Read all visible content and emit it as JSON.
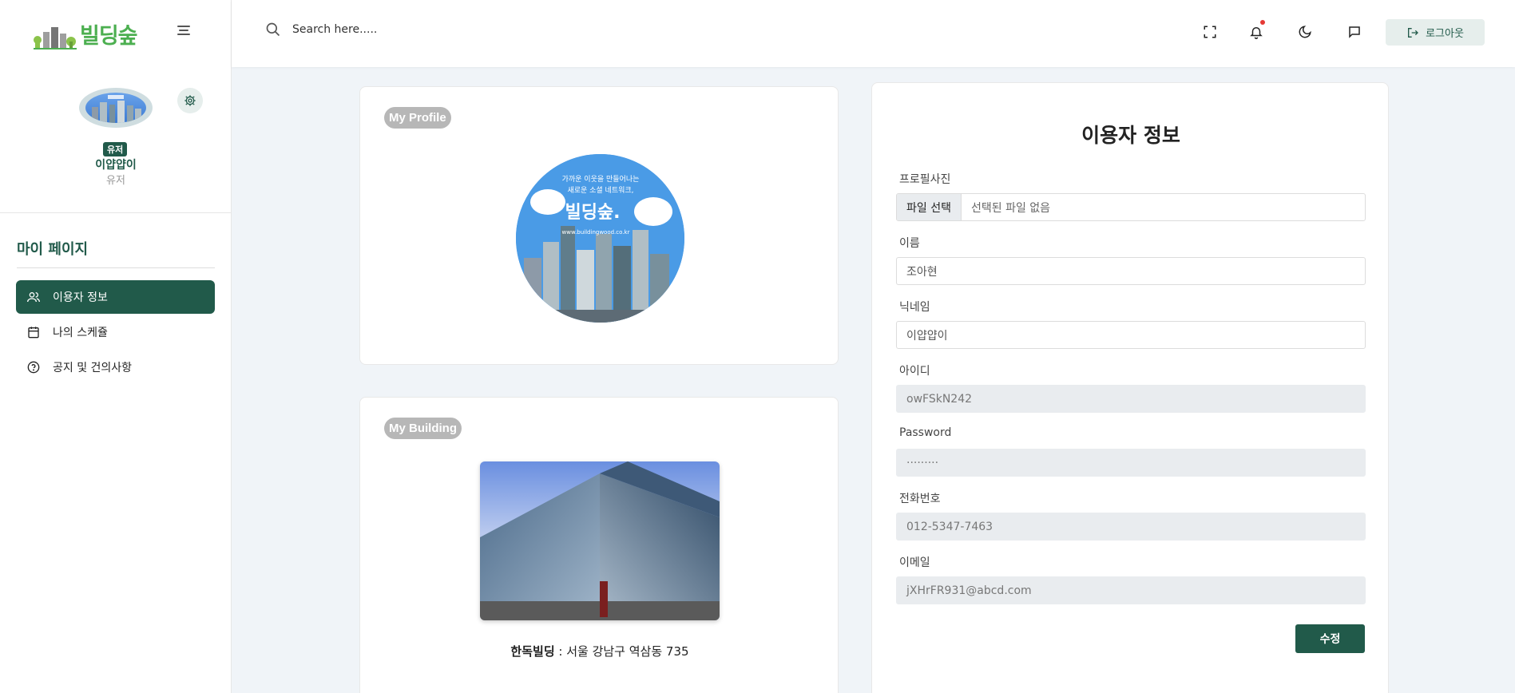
{
  "app": {
    "logo_text": "빌딩숲"
  },
  "header": {
    "search_placeholder": "Search here.....",
    "logout_label": "로그아웃",
    "icons": [
      "fullscreen-icon",
      "bell-icon",
      "moon-icon",
      "chat-icon"
    ]
  },
  "sidebar": {
    "profile": {
      "badge": "유저",
      "nickname": "이얍얍이",
      "role": "유저"
    },
    "nav_title": "마이 페이지",
    "items": [
      {
        "label": "이용자 정보",
        "icon": "users-icon",
        "active": true
      },
      {
        "label": "나의 스케쥴",
        "icon": "calendar-icon",
        "active": false
      },
      {
        "label": "공지 및 건의사항",
        "icon": "question-circle-icon",
        "active": false
      }
    ]
  },
  "profile_card": {
    "label": "My Profile",
    "photo_text": {
      "tagline1": "가까운 이웃을 만들어나는",
      "tagline2": "새로운 소셜 네트워크,",
      "brand": "빌딩숲.",
      "url": "www.buildingwood.co.kr"
    }
  },
  "building_card": {
    "label": "My Building",
    "caption_name": "한독빌딩",
    "caption_address": " : 서울 강남구 역삼동 735"
  },
  "form": {
    "title": "이용자 정보",
    "photo_label": "프로필사진",
    "file_button": "파일 선택",
    "file_status": "선택된 파일 없음",
    "name_label": "이름",
    "name_value": "조아현",
    "nickname_label": "닉네임",
    "nickname_value": "이얍얍이",
    "id_label": "아이디",
    "id_value": "owFSkN242",
    "password_label": "Password",
    "password_value": "·········",
    "phone_label": "전화번호",
    "phone_value": "012-5347-7463",
    "email_label": "이메일",
    "email_value": "jXHrFR931@abcd.com",
    "submit_label": "수정"
  },
  "colors": {
    "primary": "#215a4a",
    "logo_green": "#4caf50",
    "notify": "#e53935"
  }
}
